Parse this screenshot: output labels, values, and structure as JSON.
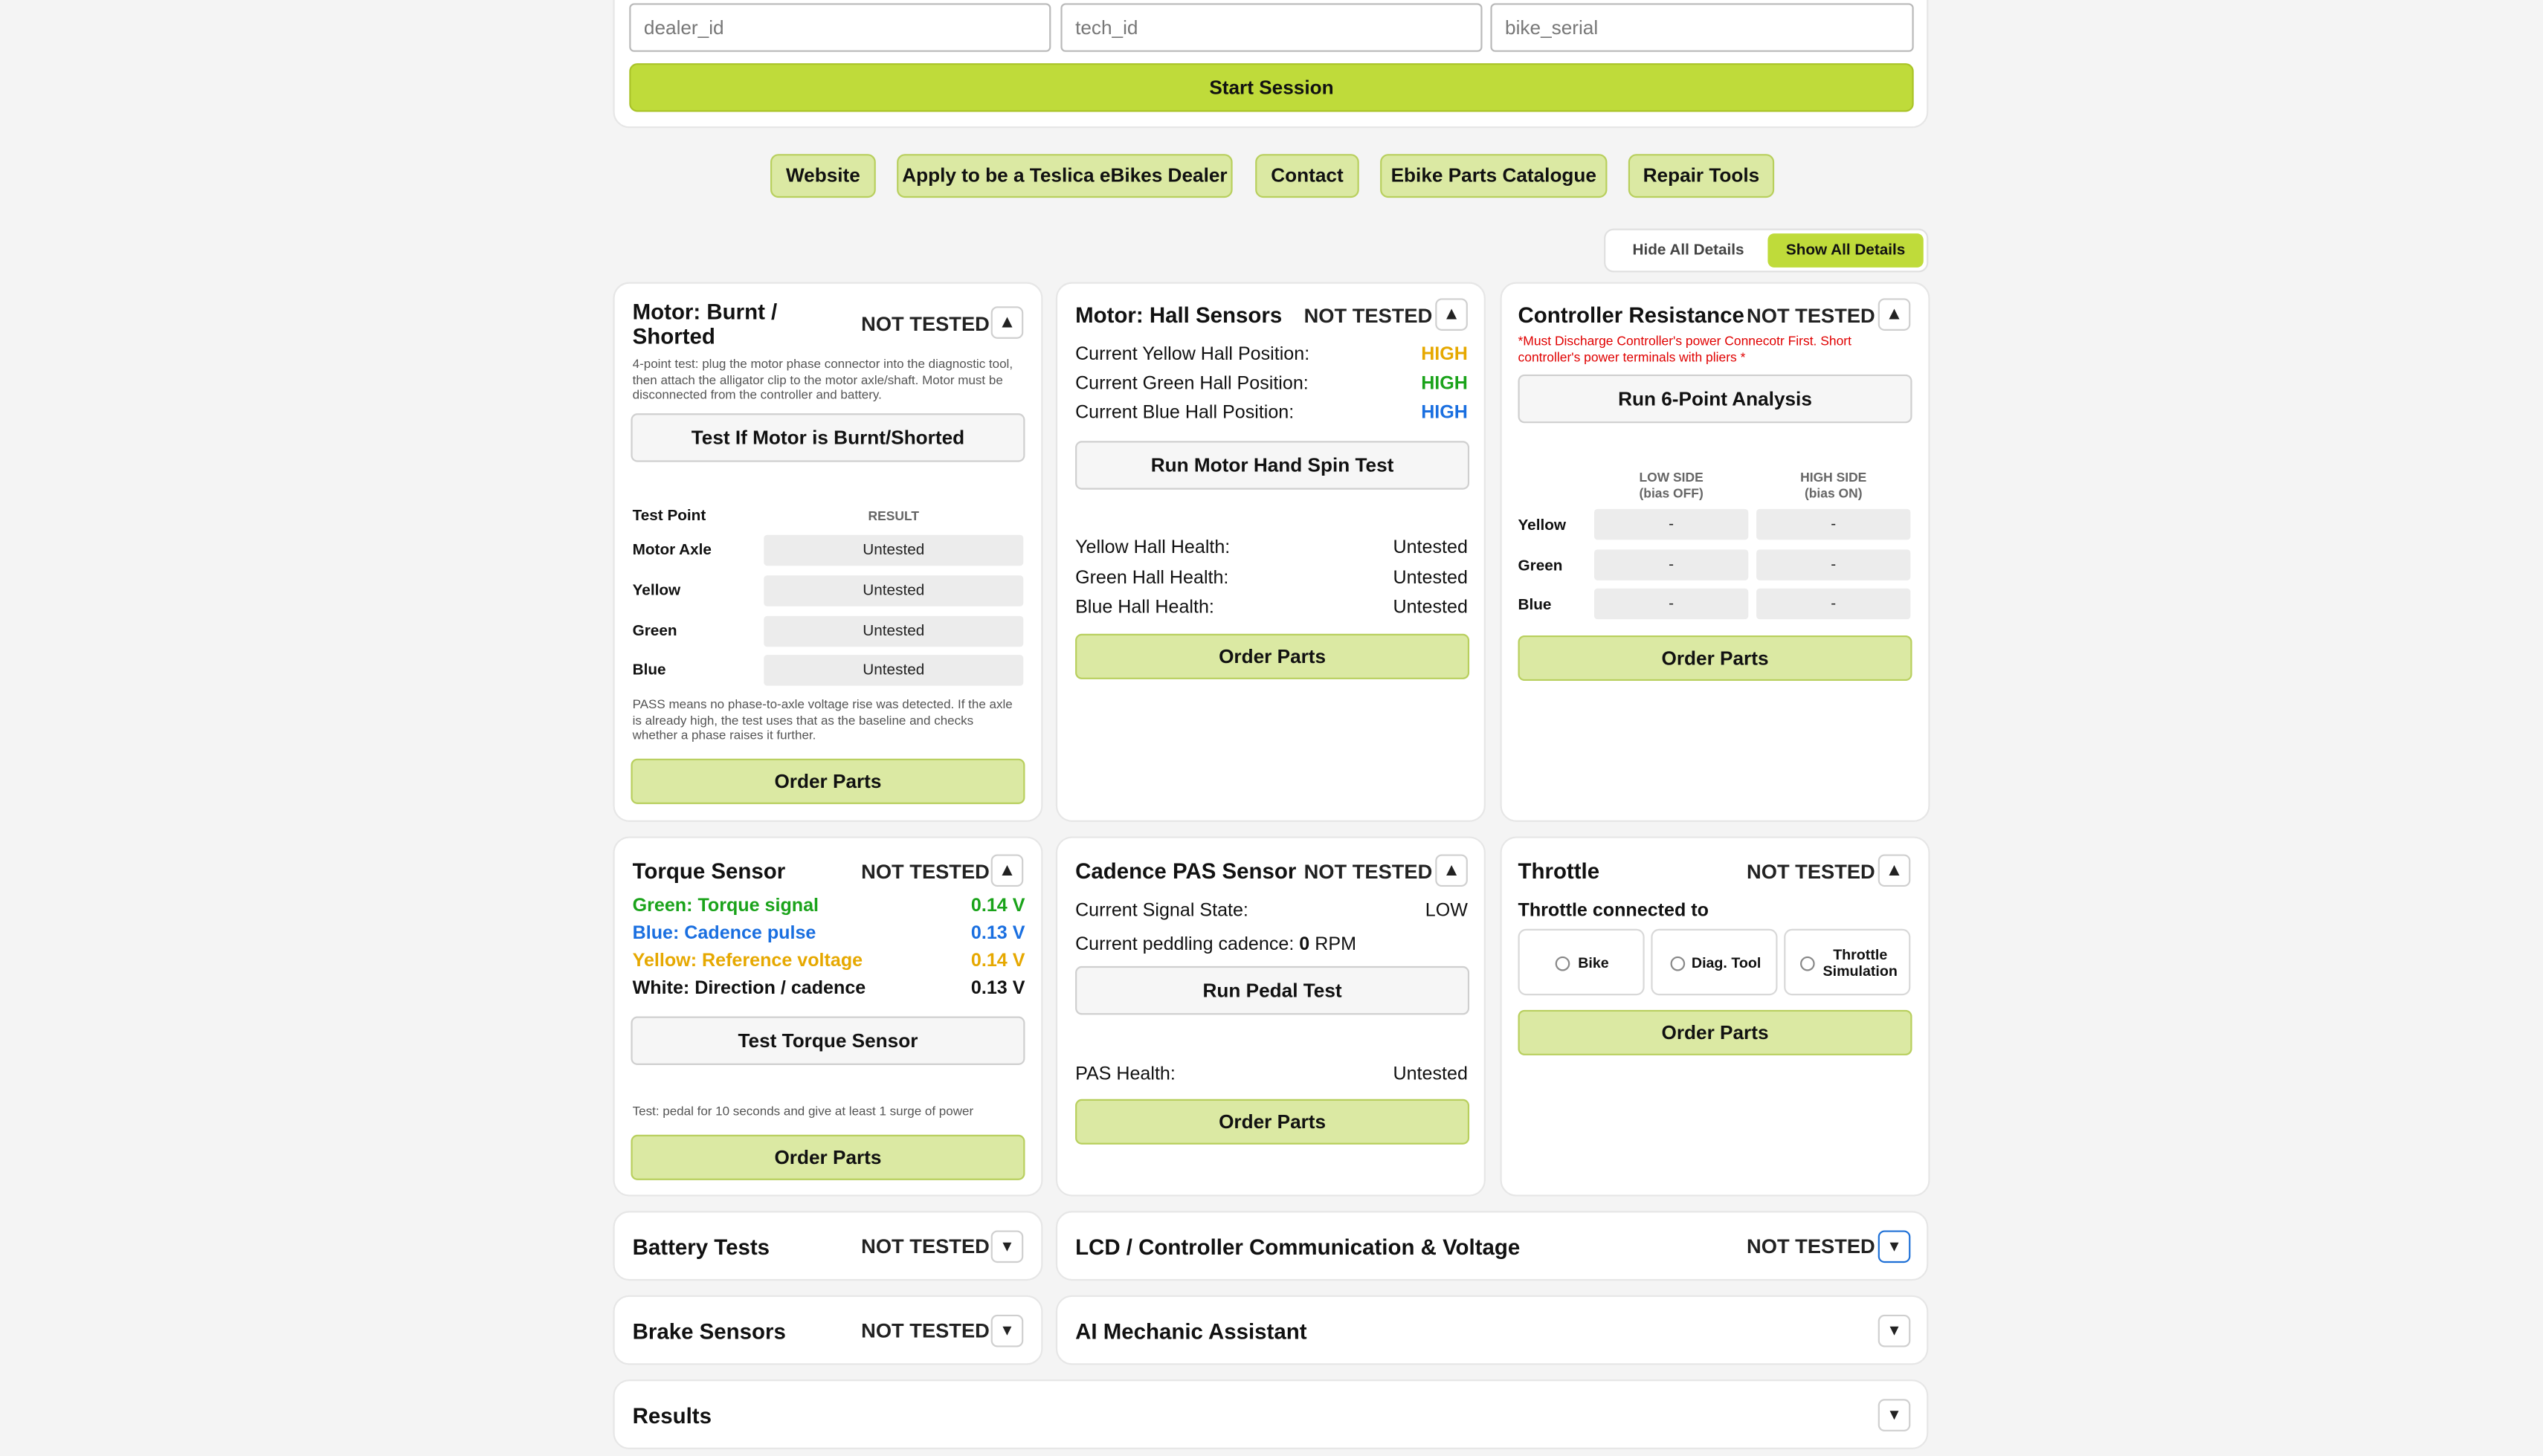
{
  "session": {
    "dealer_placeholder": "dealer_id",
    "tech_placeholder": "tech_id",
    "serial_placeholder": "bike_serial",
    "start_label": "Start Session"
  },
  "nav": [
    "Website",
    "Apply to be a Teslica eBikes Dealer",
    "Contact",
    "Ebike Parts Catalogue",
    "Repair Tools"
  ],
  "toggle": {
    "hide": "Hide All Details",
    "show": "Show All Details"
  },
  "status_not_tested": "NOT TESTED",
  "order_parts": "Order Parts",
  "motor_burnt": {
    "title_line1": "Motor: Burnt /",
    "title_line2": "Shorted",
    "desc": "4-point test: plug the motor phase connector into the diagnostic tool, then attach the alligator clip to the motor axle/shaft. Motor must be disconnected from the controller and battery.",
    "button": "Test If Motor is Burnt/Shorted",
    "col_point": "Test Point",
    "col_result": "RESULT",
    "rows": [
      {
        "point": "Motor Axle",
        "result": "Untested"
      },
      {
        "point": "Yellow",
        "result": "Untested"
      },
      {
        "point": "Green",
        "result": "Untested"
      },
      {
        "point": "Blue",
        "result": "Untested"
      }
    ],
    "note": "PASS means no phase-to-axle voltage rise was detected. If the axle is already high, the test uses that as the baseline and checks whether a phase raises it further."
  },
  "hall": {
    "title": "Motor: Hall Sensors",
    "positions": [
      {
        "label": "Current Yellow Hall Position:",
        "value": "HIGH",
        "color": "#e6a800"
      },
      {
        "label": "Current Green Hall Position:",
        "value": "HIGH",
        "color": "#1aa31a"
      },
      {
        "label": "Current Blue Hall Position:",
        "value": "HIGH",
        "color": "#1a6fe0"
      }
    ],
    "button": "Run Motor Hand Spin Test",
    "health": [
      {
        "label": "Yellow Hall Health:",
        "value": "Untested"
      },
      {
        "label": "Green Hall Health:",
        "value": "Untested"
      },
      {
        "label": "Blue Hall Health:",
        "value": "Untested"
      }
    ]
  },
  "controller": {
    "title": "Controller Resistance",
    "warning": "*Must Discharge Controller's power Connecotr First. Short controller's power terminals with pliers *",
    "button": "Run 6-Point Analysis",
    "low_h1": "LOW SIDE",
    "low_h2": "(bias OFF)",
    "high_h1": "HIGH SIDE",
    "high_h2": "(bias ON)",
    "rows": [
      {
        "label": "Yellow",
        "low": "-",
        "high": "-"
      },
      {
        "label": "Green",
        "low": "-",
        "high": "-"
      },
      {
        "label": "Blue",
        "low": "-",
        "high": "-"
      }
    ]
  },
  "torque": {
    "title": "Torque Sensor",
    "signals": [
      {
        "label": "Green: Torque signal",
        "value": "0.14 V",
        "color": "#1aa31a"
      },
      {
        "label": "Blue: Cadence pulse",
        "value": "0.13 V",
        "color": "#1a6fe0"
      },
      {
        "label": "Yellow: Reference voltage",
        "value": "0.14 V",
        "color": "#e6a800"
      },
      {
        "label": "White: Direction / cadence",
        "value": "0.13 V",
        "color": "#111111"
      }
    ],
    "button": "Test Torque Sensor",
    "note": "Test: pedal for 10 seconds and give at least 1 surge of power"
  },
  "cadence": {
    "title": "Cadence PAS Sensor",
    "signal_label": "Current Signal State:",
    "signal_value": "LOW",
    "cadence_prefix": "Current peddling cadence:",
    "cadence_value": "0",
    "cadence_unit": "RPM",
    "button": "Run Pedal Test",
    "health_label": "PAS Health:",
    "health_value": "Untested"
  },
  "throttle": {
    "title": "Throttle",
    "connected_label": "Throttle connected to",
    "options": [
      "Bike",
      "Diag. Tool",
      "Throttle",
      "Simulation"
    ]
  },
  "battery": {
    "title": "Battery Tests"
  },
  "lcd": {
    "title": "LCD / Controller Communication & Voltage"
  },
  "brake": {
    "title": "Brake Sensors"
  },
  "ai": {
    "title": "AI Mechanic Assistant"
  },
  "results": {
    "title": "Results"
  },
  "icons": {
    "collapse": "▲",
    "expand": "▾"
  }
}
